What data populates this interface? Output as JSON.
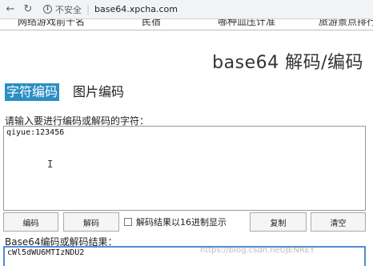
{
  "browser": {
    "security_text": "不安全",
    "url": "base64.xpcha.com"
  },
  "top_links": [
    "网络游戏前十名",
    "民宿",
    "哪种血压计准",
    "旅游景点排行"
  ],
  "heading": "base64 解码/编码",
  "tabs": [
    {
      "label": "字符编码",
      "active": true
    },
    {
      "label": "图片编码",
      "active": false
    }
  ],
  "input": {
    "label": "请输入要进行编码或解码的字符：",
    "value": "qiyue:123456"
  },
  "buttons": {
    "encode": "编码",
    "decode": "解码",
    "hex_option": "解码结果以16进制显示",
    "copy": "复制",
    "clear": "清空"
  },
  "result": {
    "label": "Base64编码或解码结果：",
    "value": "cWl5dWU6MTIzNDU2"
  },
  "watermark": "https://blog.csdn.net/JENREY",
  "colors": {
    "tab_active_bg": "#2a8fc3",
    "output_border": "#4e8fd6"
  }
}
